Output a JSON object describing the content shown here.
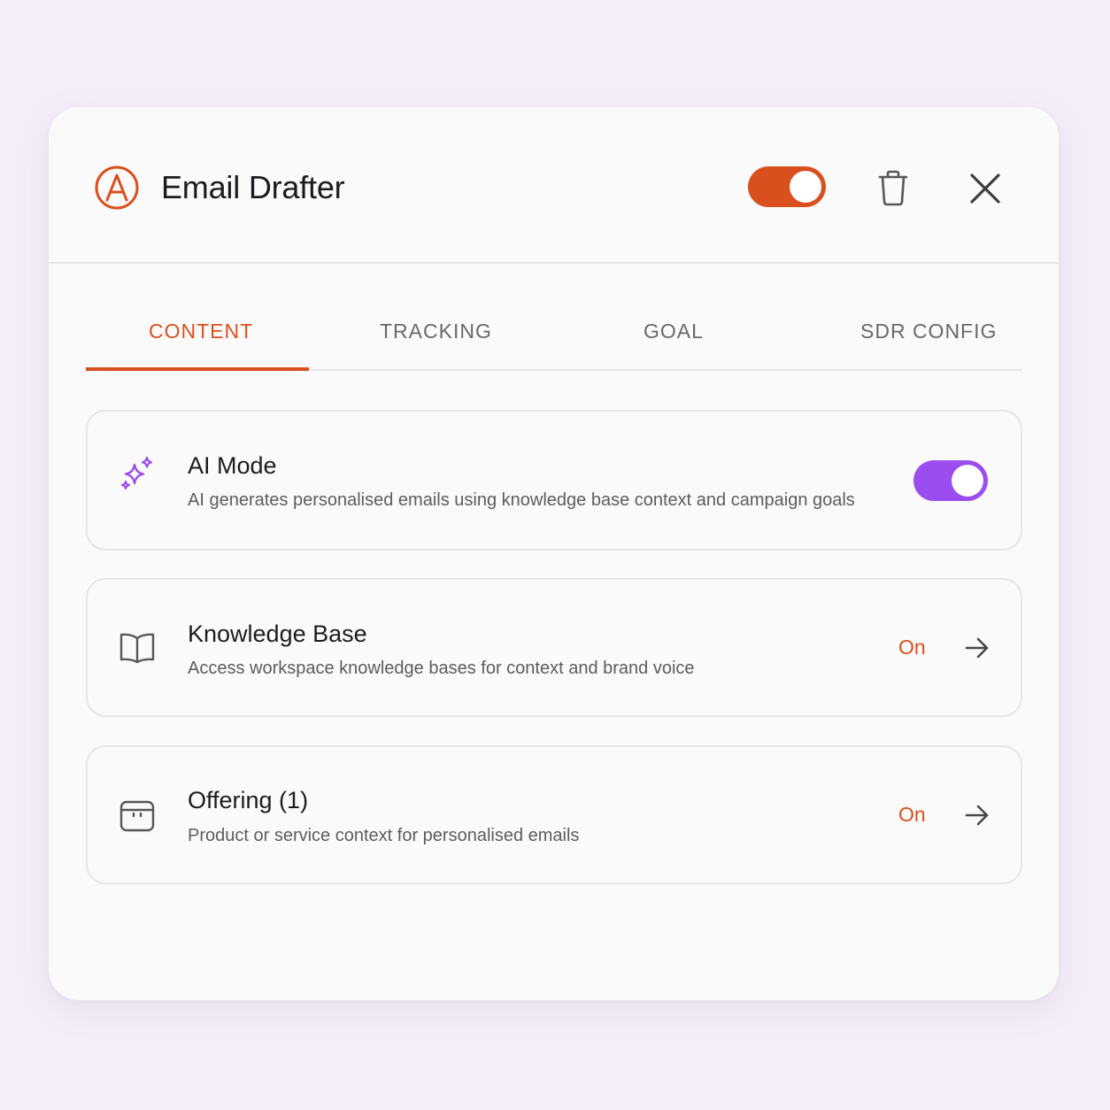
{
  "header": {
    "title": "Email Drafter",
    "logo_icon": "anthropic-logo-icon",
    "enabled": true,
    "delete_icon": "trash-icon",
    "close_icon": "close-icon"
  },
  "tabs": [
    {
      "label": "CONTENT",
      "active": true
    },
    {
      "label": "TRACKING",
      "active": false
    },
    {
      "label": "GOAL",
      "active": false
    },
    {
      "label": "SDR CONFIG",
      "active": false
    }
  ],
  "cards": [
    {
      "icon": "sparkles-icon",
      "title": "AI Mode",
      "description": "AI generates personalised emails using knowledge base context and campaign goals",
      "enabled": true
    },
    {
      "icon": "book-icon",
      "title": "Knowledge Base",
      "description": "Access workspace knowledge bases for context and brand voice",
      "status": "On",
      "action_icon": "arrow-right-icon"
    },
    {
      "icon": "box-icon",
      "title": "Offering (1)",
      "description": "Product or service context for personalised emails",
      "status": "On",
      "action_icon": "arrow-right-icon"
    }
  ],
  "colors": {
    "accent": "#d9501e",
    "ai_accent": "#9b4df0",
    "background": "#f5eef9"
  }
}
